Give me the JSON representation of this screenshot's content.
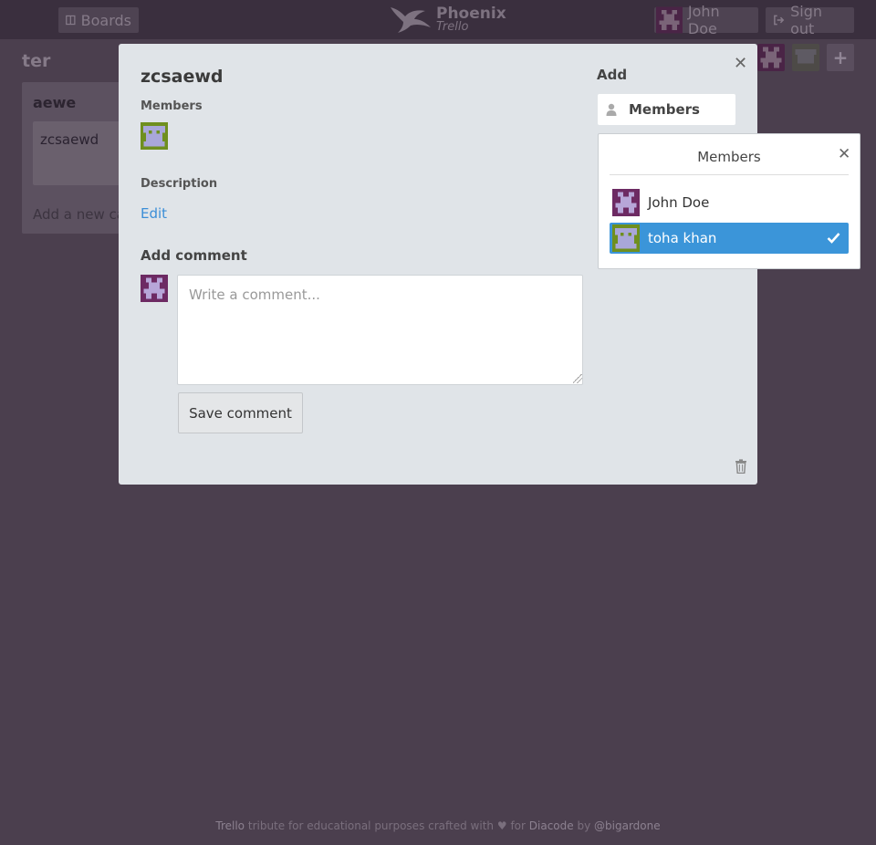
{
  "nav": {
    "boards_label": "Boards",
    "user_name": "John Doe",
    "signout_label": "Sign out",
    "logo_line1": "Phoenix",
    "logo_line2": "Trello"
  },
  "board": {
    "title": "ter",
    "list": {
      "title": "aewe",
      "cards": [
        "zcsaewd"
      ],
      "add_card_label": "Add a new card..."
    }
  },
  "card_modal": {
    "title": "zcsaewd",
    "members_label": "Members",
    "description_label": "Description",
    "edit_label": "Edit",
    "add_comment_label": "Add comment",
    "comment_placeholder": "Write a comment...",
    "save_comment_label": "Save comment",
    "add_section_title": "Add",
    "add_members_button": "Members"
  },
  "members_popover": {
    "title": "Members",
    "members": [
      {
        "name": "John Doe",
        "selected": false
      },
      {
        "name": "toha khan",
        "selected": true
      }
    ]
  },
  "footer": {
    "brand": "Trello",
    "text_mid": "tribute for educational purposes crafted with",
    "heart": "♥",
    "text_for": "for",
    "company": "Diacode",
    "text_by": "by",
    "author": "@bigardone"
  },
  "colors": {
    "background": "#4b3f4e",
    "accent_blue": "#3b95d9",
    "avatar_purple": "#6d2a63",
    "avatar_green": "#6f8f1f"
  }
}
